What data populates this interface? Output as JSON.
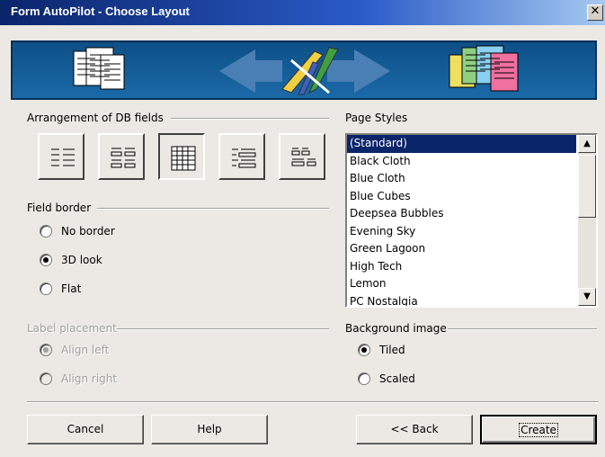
{
  "window": {
    "title": "Form AutoPilot - Choose Layout",
    "close_glyph": "✕"
  },
  "arrangement": {
    "label": "Arrangement of DB fields",
    "options": [
      {
        "icon": "columnar-left-icon",
        "selected": false
      },
      {
        "icon": "columnar-top-icon",
        "selected": false
      },
      {
        "icon": "datasheet-icon",
        "selected": true
      },
      {
        "icon": "block-left-icon",
        "selected": false
      },
      {
        "icon": "block-top-icon",
        "selected": false
      }
    ]
  },
  "field_border": {
    "label": "Field border",
    "options": [
      {
        "label": "No border",
        "checked": false
      },
      {
        "label": "3D look",
        "checked": true
      },
      {
        "label": "Flat",
        "checked": false
      }
    ]
  },
  "label_placement": {
    "label": "Label placement",
    "options": [
      {
        "label": "Align left",
        "checked": true
      },
      {
        "label": "Align right",
        "checked": false
      }
    ]
  },
  "page_styles": {
    "label": "Page Styles",
    "items": [
      "(Standard)",
      "Black Cloth",
      "Blue Cloth",
      "Blue Cubes",
      "Deepsea Bubbles",
      "Evening Sky",
      "Green Lagoon",
      "High Tech",
      "Lemon",
      "PC Nostalgia"
    ],
    "selected": "(Standard)"
  },
  "background_image": {
    "label": "Background image",
    "options": [
      {
        "label": "Tiled",
        "checked": true
      },
      {
        "label": "Scaled",
        "checked": false
      }
    ]
  },
  "buttons": {
    "cancel": "Cancel",
    "help": "Help",
    "back": "<< Back",
    "create": "Create"
  },
  "colors": {
    "title_bar": "#0a246a",
    "banner": "#1a6aa8",
    "selection": "#0a246a",
    "dialog_bg": "#ece9e4"
  }
}
